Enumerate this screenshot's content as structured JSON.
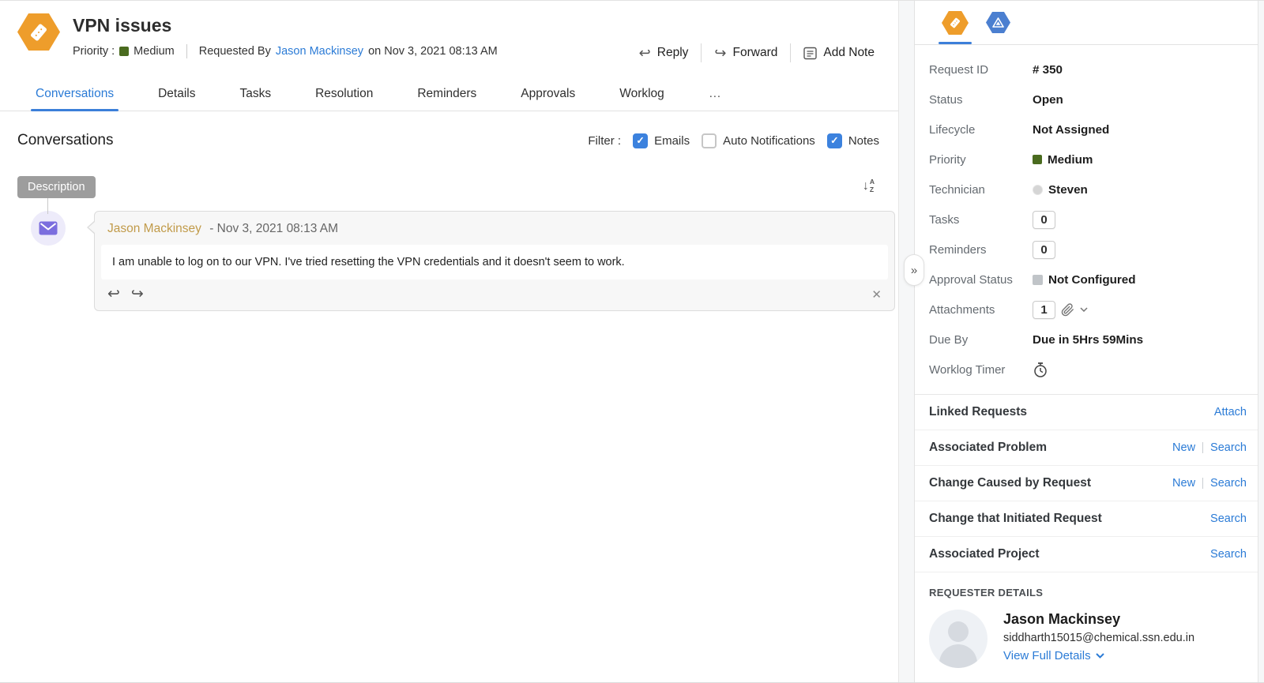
{
  "header": {
    "title": "VPN issues",
    "priority_label": "Priority :",
    "priority_value": "Medium",
    "requested_by_label": "Requested By",
    "requester_name": "Jason Mackinsey",
    "requested_on": "on Nov 3, 2021 08:13 AM",
    "actions": {
      "reply": "Reply",
      "forward": "Forward",
      "add_note": "Add Note"
    }
  },
  "tabs": {
    "items": [
      "Conversations",
      "Details",
      "Tasks",
      "Resolution",
      "Reminders",
      "Approvals",
      "Worklog"
    ],
    "overflow": "…",
    "active": "Conversations"
  },
  "conversations": {
    "heading": "Conversations",
    "filter_label": "Filter :",
    "filters": [
      {
        "label": "Emails",
        "checked": true
      },
      {
        "label": "Auto Notifications",
        "checked": false
      },
      {
        "label": "Notes",
        "checked": true
      }
    ],
    "description_badge": "Description",
    "message": {
      "author": "Jason Mackinsey",
      "timestamp": "- Nov 3, 2021 08:13 AM",
      "body": "I am unable to log on to our VPN. I've tried resetting the VPN credentials and it doesn't seem to work."
    }
  },
  "sidebar": {
    "fields": [
      {
        "label": "Request ID",
        "value": "# 350"
      },
      {
        "label": "Status",
        "value": "Open"
      },
      {
        "label": "Lifecycle",
        "value": "Not Assigned"
      },
      {
        "label": "Priority",
        "value": "Medium"
      },
      {
        "label": "Technician",
        "value": "Steven"
      },
      {
        "label": "Tasks",
        "value": "0"
      },
      {
        "label": "Reminders",
        "value": "0"
      },
      {
        "label": "Approval Status",
        "value": "Not Configured"
      },
      {
        "label": "Attachments",
        "value": "1"
      },
      {
        "label": "Due By",
        "value": "Due in 5Hrs 59Mins"
      },
      {
        "label": "Worklog Timer",
        "value": ""
      }
    ],
    "sections": [
      {
        "title": "Linked Requests",
        "links": [
          "Attach"
        ]
      },
      {
        "title": "Associated Problem",
        "links": [
          "New",
          "Search"
        ]
      },
      {
        "title": "Change Caused by Request",
        "links": [
          "New",
          "Search"
        ]
      },
      {
        "title": "Change that Initiated Request",
        "links": [
          "Search"
        ]
      },
      {
        "title": "Associated Project",
        "links": [
          "Search"
        ]
      }
    ],
    "requester": {
      "section_title": "REQUESTER DETAILS",
      "name": "Jason Mackinsey",
      "email": "siddharth15015@chemical.ssn.edu.in",
      "view_link": "View Full Details"
    }
  },
  "icons": {
    "reply_glyph": "↩",
    "forward_glyph": "↪",
    "close_glyph": "✕",
    "collapse_glyph": "»",
    "check_glyph": "✓",
    "sort_arrow": "↓",
    "sort_a": "A",
    "sort_z": "Z"
  },
  "colors": {
    "accent_blue": "#2b7bd6",
    "priority_green": "#4a6b1f",
    "brand_orange": "#ee9d2b",
    "asset_hex_blue": "#4b7fd0",
    "author_gold": "#c19b4a",
    "not_configured_gray": "#c0c4c8"
  }
}
